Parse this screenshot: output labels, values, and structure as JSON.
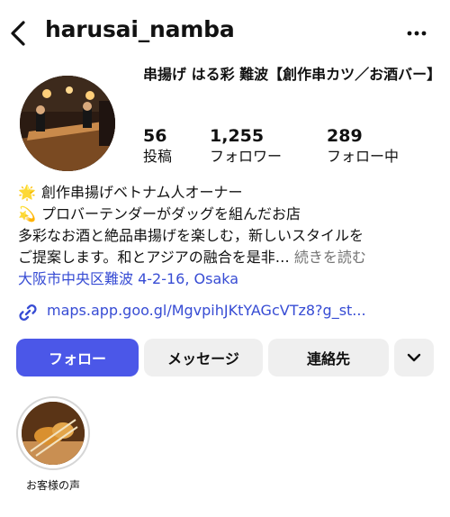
{
  "header": {
    "username": "harusai_namba"
  },
  "profile": {
    "display_name": "串揚げ はる彩 難波【創作串カツ／お酒バー】",
    "stats": {
      "posts": {
        "value": "56",
        "label": "投稿"
      },
      "followers": {
        "value": "1,255",
        "label": "フォロワー"
      },
      "following": {
        "value": "289",
        "label": "フォロー中"
      }
    }
  },
  "bio": {
    "line1_emoji": "🌟",
    "line1": "創作串揚げベトナム人オーナー",
    "line2_emoji": "💫",
    "line2": "プロバーテンダーがダッグを組んだお店",
    "line3": "多彩なお酒と絶品串揚げを楽しむ，新しいスタイルを",
    "line4": "ご提案します。和とアジアの融合を是非…",
    "more": "続きを読む",
    "location": "大阪市中央区難波 4-2-16, Osaka",
    "link": "maps.app.goo.gl/MgvpihJKtYAGcVTz8?g_st..."
  },
  "actions": {
    "follow": "フォロー",
    "message": "メッセージ",
    "contact": "連絡先"
  },
  "highlights": [
    {
      "label": "お客様の声"
    }
  ],
  "colors": {
    "accent": "#4b57e8",
    "link": "#374cd4",
    "button_bg": "#efefef"
  },
  "icons": {
    "back": "back-arrow-icon",
    "more": "more-dots-icon",
    "link": "link-chain-icon",
    "chevron": "chevron-down-icon"
  }
}
